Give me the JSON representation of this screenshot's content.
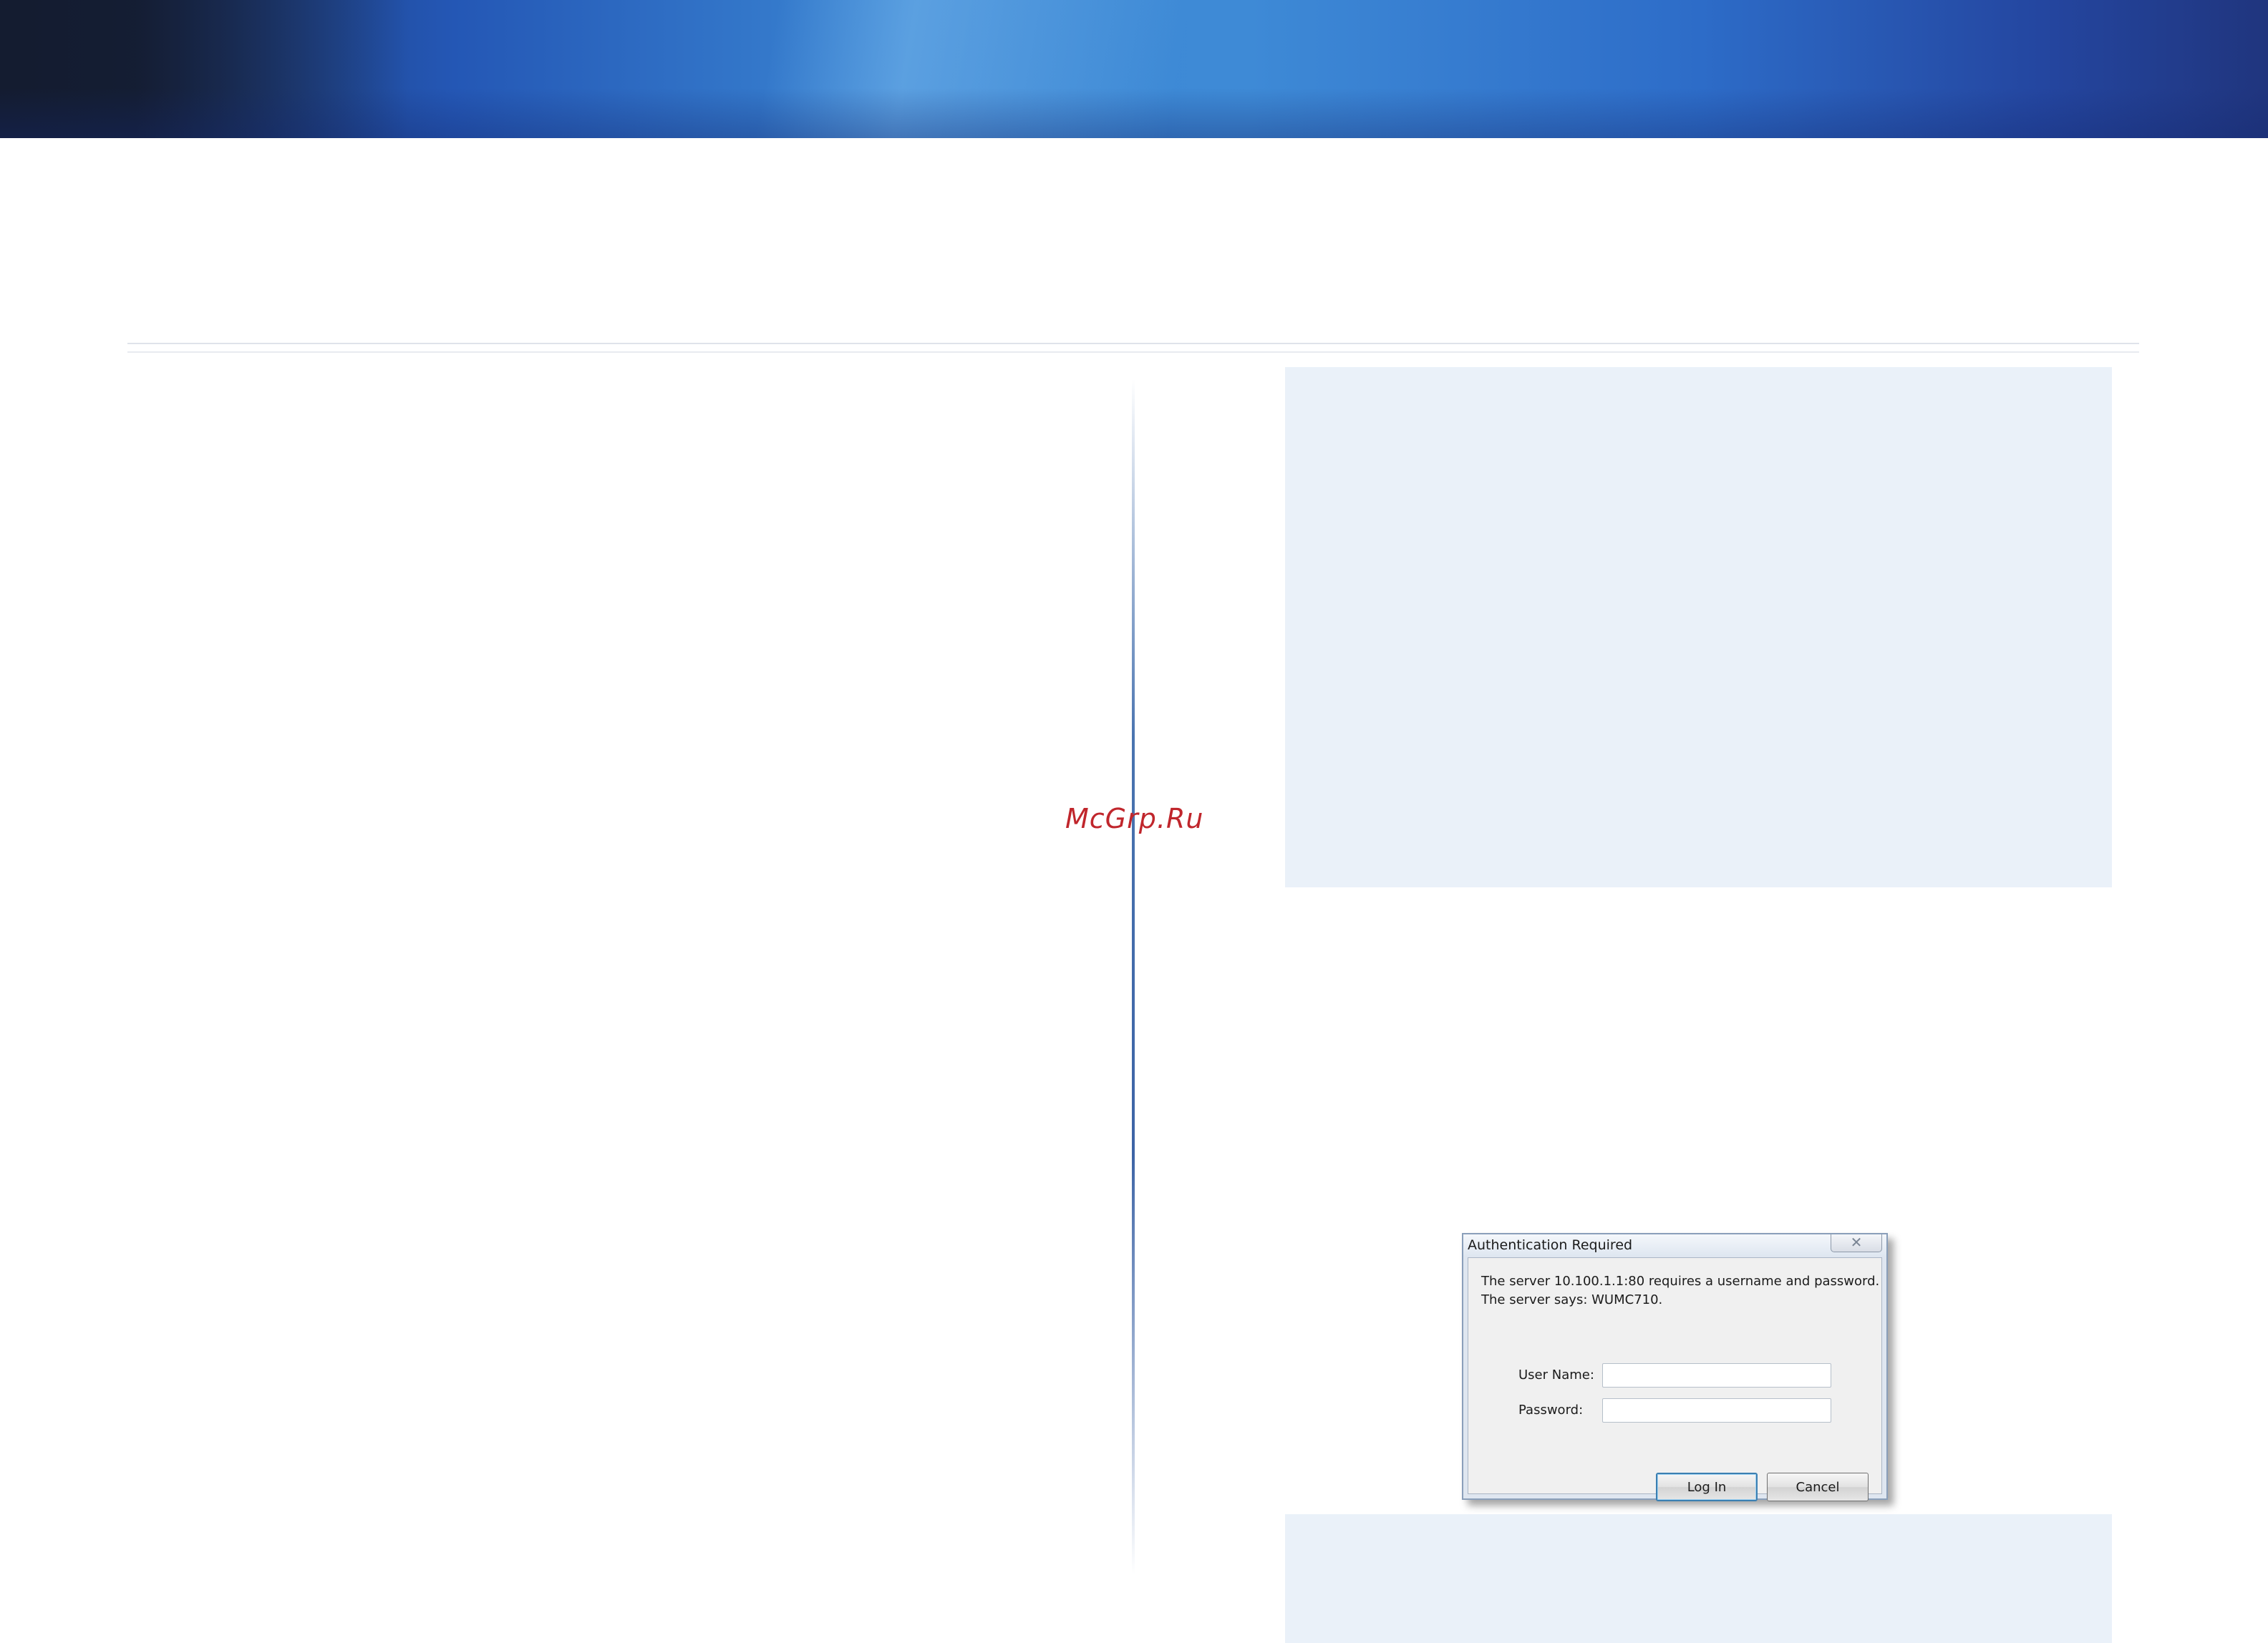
{
  "watermark": "McGrp.Ru",
  "dialog": {
    "title": "Authentication Required",
    "close_glyph": "✕",
    "message_line1": "The server 10.100.1.1:80 requires a username and password.",
    "message_line2": "The server says: WUMC710.",
    "username_label": "User Name:",
    "username_value": "",
    "password_label": "Password:",
    "password_value": "",
    "login_label": "Log In",
    "cancel_label": "Cancel"
  }
}
